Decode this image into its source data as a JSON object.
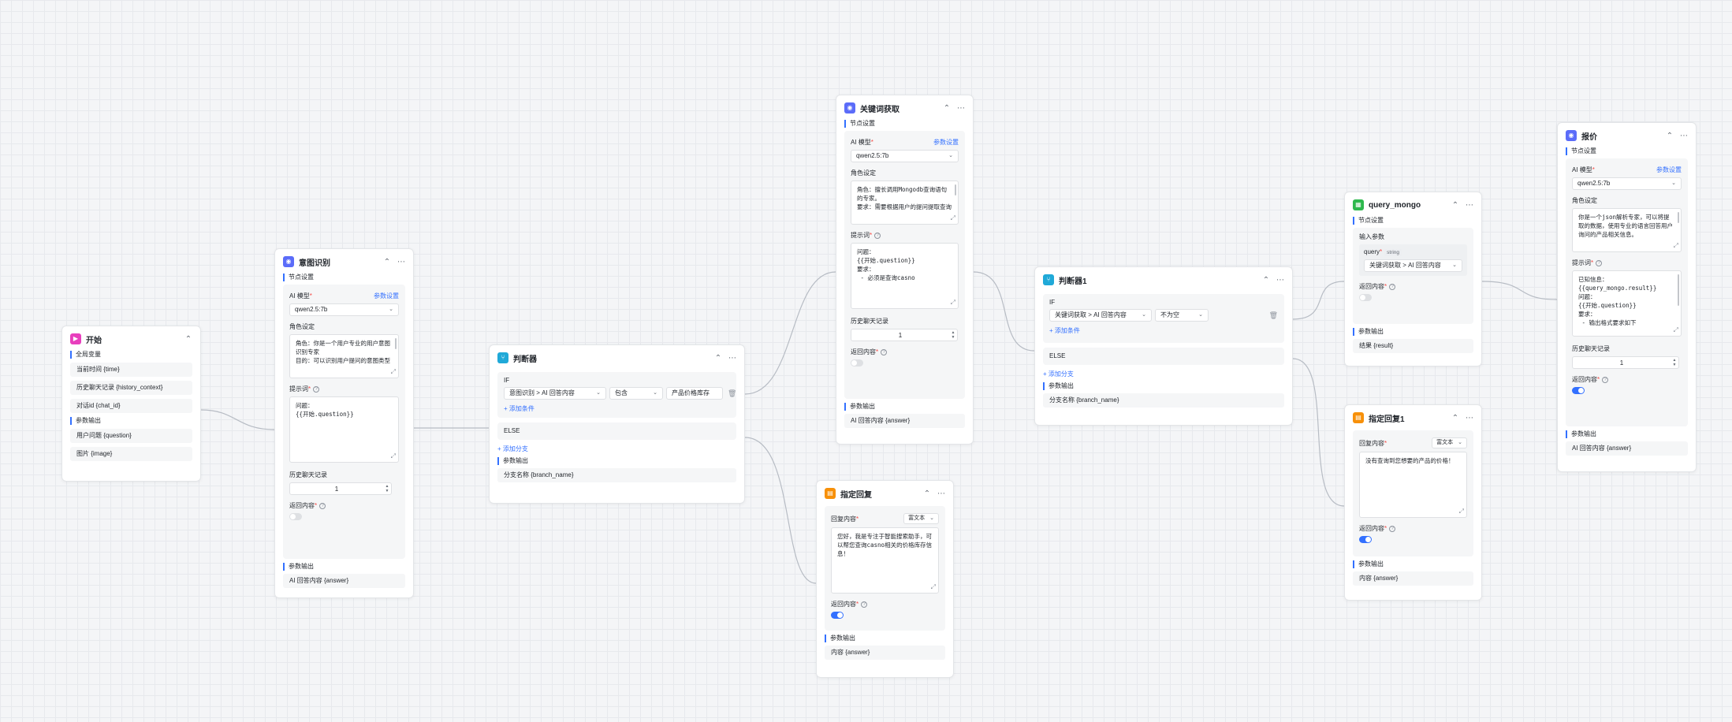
{
  "icons": {
    "start": "play-icon",
    "ai": "robot-icon",
    "condition": "branch-icon",
    "reply": "message-icon",
    "db": "database-icon"
  },
  "colors": {
    "accent": "#3370ff",
    "start": "#e83fbd",
    "ai": "#5b6cf9",
    "condition": "#20a9d8",
    "reply": "#f79009",
    "db": "#2db84d"
  },
  "common": {
    "node_settings": "节点设置",
    "ai_model": "AI 模型",
    "param_settings": "参数设置",
    "model_value": "qwen2.5:7b",
    "role_setting": "角色设定",
    "prompt": "提示词",
    "history": "历史聊天记录",
    "return_content": "返回内容",
    "param_output": "参数输出",
    "ai_answer": "AI 回答内容 {answer}",
    "add_condition": "+ 添加条件",
    "add_branch": "+ 添加分支",
    "else": "ELSE",
    "if": "IF",
    "branch_name": "分支名称 {branch_name}",
    "reply_content": "回复内容",
    "rich_text": "富文本",
    "content_answer": "内容 {answer}"
  },
  "start": {
    "title": "开始",
    "global_vars": "全局变量",
    "items_global": [
      "当前时间 {time}",
      "历史聊天记录 {history_context}",
      "对话id {chat_id}"
    ],
    "param_output": "参数输出",
    "items_out": [
      "用户问题 {question}",
      "图片 {image}"
    ]
  },
  "intent": {
    "title": "意图识别",
    "role_text": "角色：你是一个用户专业的用户意图识别专家\n目的：可以识别用户提问的意图类型",
    "prompt_text": "问题：\n{{开始.question}}",
    "history_value": "1"
  },
  "cond1": {
    "title": "判断器",
    "field": "意图识别 > AI 回答内容",
    "op": "包含",
    "value": "产品价格库存"
  },
  "keyword": {
    "title": "关键词获取",
    "role_text": "角色：擅长调用Mongodb查询语句的专家。\n要求：需要根据用户的提问提取查询",
    "prompt_text": "问题：\n{{开始.question}}\n要求：\n - 必须是查询casno",
    "history_value": "1"
  },
  "reply1": {
    "title": "指定回复",
    "text": "您好，我是专注于智能搜索助手，可以帮您查询casno相关的价格库存信息！"
  },
  "cond2": {
    "title": "判断器1",
    "field": "关键词获取 > AI 回答内容",
    "op": "不为空"
  },
  "mongo": {
    "title": "query_mongo",
    "input_params": "输入参数",
    "param_name": "query",
    "param_type": "string",
    "param_value": "关键词获取 > AI 回答内容",
    "result": "结果 {result}"
  },
  "reply2": {
    "title": "指定回复1",
    "text": "没有查询到您想要的产品的价格！"
  },
  "quote": {
    "title": "报价",
    "role_text": "你是一个json解析专家，可以将提取的数据，使用专业的语言回答用户询问的产品相关信息。",
    "prompt_text": "已知信息：\n{{query_mongo.result}}\n问题：\n{{开始.question}}\n要求：\n - 输出格式要求如下",
    "history_value": "1"
  }
}
